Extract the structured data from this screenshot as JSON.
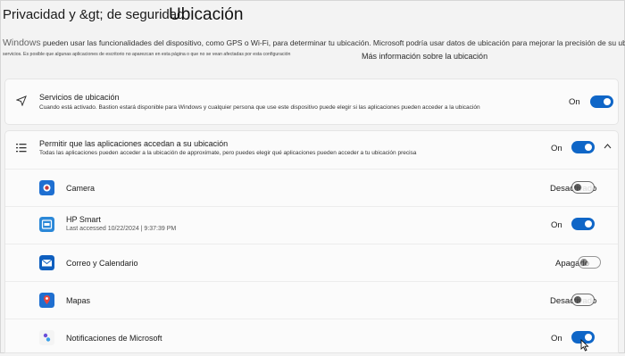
{
  "header": {
    "breadcrumb": "Privacidad y &gt; de seguridad",
    "title": "Ubicación"
  },
  "description": {
    "lead_word": "Windows",
    "line1": " pueden usar las funcionalidades del dispositivo, como GPS o Wi-Fi, para determinar tu ubicación. Microsoft podría usar datos de ubicación para mejorar la precisión de su ubicación",
    "line2": "servicios.  Es posible que algunas aplicaciones de escritorio no aparezcan en esta página o que no se vean afectadas por esta configuración",
    "more_link": "Más información sobre la ubicación"
  },
  "location_services": {
    "icon": "navigation-arrow-icon",
    "title": "Servicios de ubicación",
    "subtitle": "Cuando está activado. Bastion estará disponible para Windows y cualquier persona que use este dispositivo puede elegir si las aplicaciones pueden acceder a la ubicación",
    "state": "On",
    "on": true
  },
  "app_access": {
    "icon": "list-icon",
    "title": "Permitir que las aplicaciones accedan a su ubicación",
    "subtitle": "Todas las aplicaciones pueden acceder a la ubicación de approximate, pero puedes elegir qué aplicaciones pueden acceder a tu ubicación precisa",
    "state": "On",
    "on": true,
    "expanded": true
  },
  "apps": [
    {
      "name": "Camera",
      "sub": "",
      "state": "Desactivado",
      "on": false,
      "icon": "camera-app-icon",
      "color": "#1e6fd1"
    },
    {
      "name": "HP Smart",
      "sub": "Last accessed 10/22/2024  |  9:37:39 PM",
      "state": "On",
      "on": true,
      "icon": "hp-smart-app-icon",
      "color": "#2b88d8"
    },
    {
      "name": "Correo y Calendario",
      "sub": "",
      "state": "Apagado",
      "on": false,
      "icon": "mail-app-icon",
      "color": "#0f5fbf"
    },
    {
      "name": "Mapas",
      "sub": "",
      "state": "Desactivado",
      "on": false,
      "icon": "maps-app-icon",
      "color": "#1f6fd0"
    },
    {
      "name": "Notificaciones de Microsoft",
      "sub": "",
      "state": "On",
      "on": true,
      "icon": "microsoft-notifications-app-icon",
      "color": "#6b4fd8"
    }
  ]
}
